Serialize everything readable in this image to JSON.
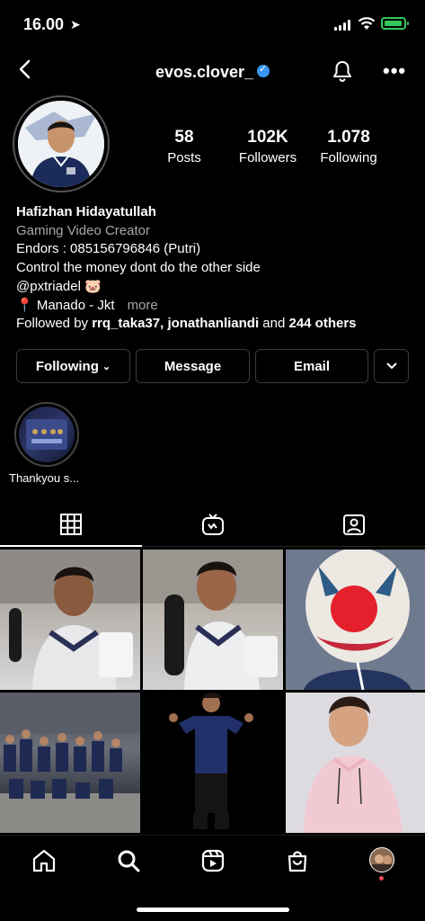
{
  "status_bar": {
    "time": "16.00"
  },
  "header": {
    "username": "evos.clover_"
  },
  "profile": {
    "stats": [
      {
        "value": "58",
        "label": "Posts"
      },
      {
        "value": "102K",
        "label": "Followers"
      },
      {
        "value": "1.078",
        "label": "Following"
      }
    ],
    "name": "Hafizhan Hidayatullah",
    "category": "Gaming Video Creator",
    "bio_lines": [
      "Endors : 085156796846 (Putri)",
      "Control the money dont do the other side",
      "@pxtriadel 🐷",
      "📍 Manado - Jkt"
    ],
    "more_label": "more",
    "followed_by": {
      "prefix": "Followed by ",
      "names": "rrq_taka37, jonathanliandi",
      "middle": " and ",
      "others": "244 others"
    }
  },
  "actions": {
    "following": "Following",
    "message": "Message",
    "email": "Email"
  },
  "highlights": [
    {
      "label": "Thankyou s..."
    }
  ],
  "colors": {
    "background": "#000000",
    "text": "#ffffff",
    "muted": "#a8a8a8",
    "verified": "#3897f0",
    "battery": "#34c759",
    "notification_dot": "#ed4956"
  }
}
